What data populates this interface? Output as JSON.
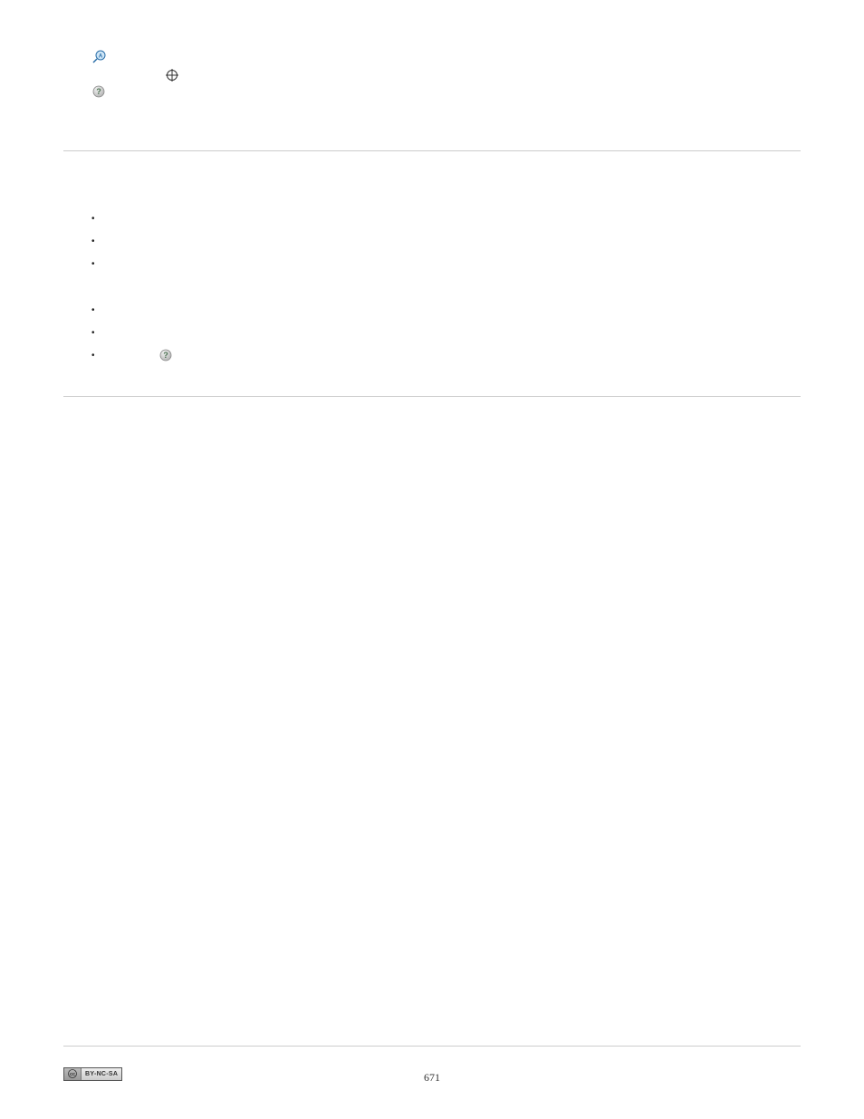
{
  "page_number": "671",
  "license_badge": {
    "left_label": "cc",
    "right_label": "BY-NC-SA"
  }
}
